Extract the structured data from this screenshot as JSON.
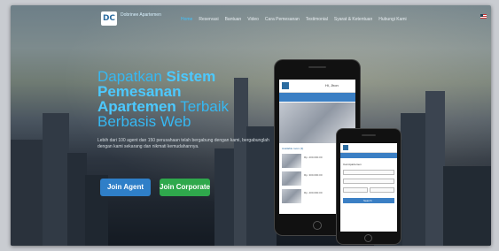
{
  "brand": {
    "logo_mark": "DC",
    "name": "Dobrinee Apartemen"
  },
  "nav": {
    "items": [
      {
        "label": "Home",
        "active": true
      },
      {
        "label": "Reservasi",
        "active": false
      },
      {
        "label": "Bantuan",
        "active": false
      },
      {
        "label": "Video",
        "active": false
      },
      {
        "label": "Cara Pemesanan",
        "active": false
      },
      {
        "label": "Testimonial",
        "active": false
      },
      {
        "label": "Syarat & Ketentuan",
        "active": false
      },
      {
        "label": "Hubungi Kami",
        "active": false
      }
    ],
    "language_icon": "us-flag-icon"
  },
  "hero": {
    "headline_1": "Dapatkan ",
    "headline_bold_1": "Sistem",
    "headline_bold_2": "Pemesanan",
    "headline_bold_3": "Apartemen",
    "headline_2": " Terbaik",
    "headline_3": "Berbasis Web",
    "description": "Lebih dari 100 agent dan 150 perusahaan telah bergabung dengan kami, bergabunglah dengan kami sekarang dan nikmati kemudahannya."
  },
  "buttons": {
    "agent": "Join Agent",
    "corporate": "Join Corporate"
  },
  "colors": {
    "accent": "#36b8f2",
    "agent_button": "#2f7fc8",
    "corporate_button": "#2fa84c"
  },
  "phone_large": {
    "user": "Hi, Jhon",
    "list_label": "Available room (3)",
    "prices": [
      "Rp. 200.000.00",
      "Rp. 300.000.00",
      "Rp. 400.000.00"
    ]
  },
  "phone_small": {
    "title": "Cek Apartemen",
    "action": "Search"
  }
}
